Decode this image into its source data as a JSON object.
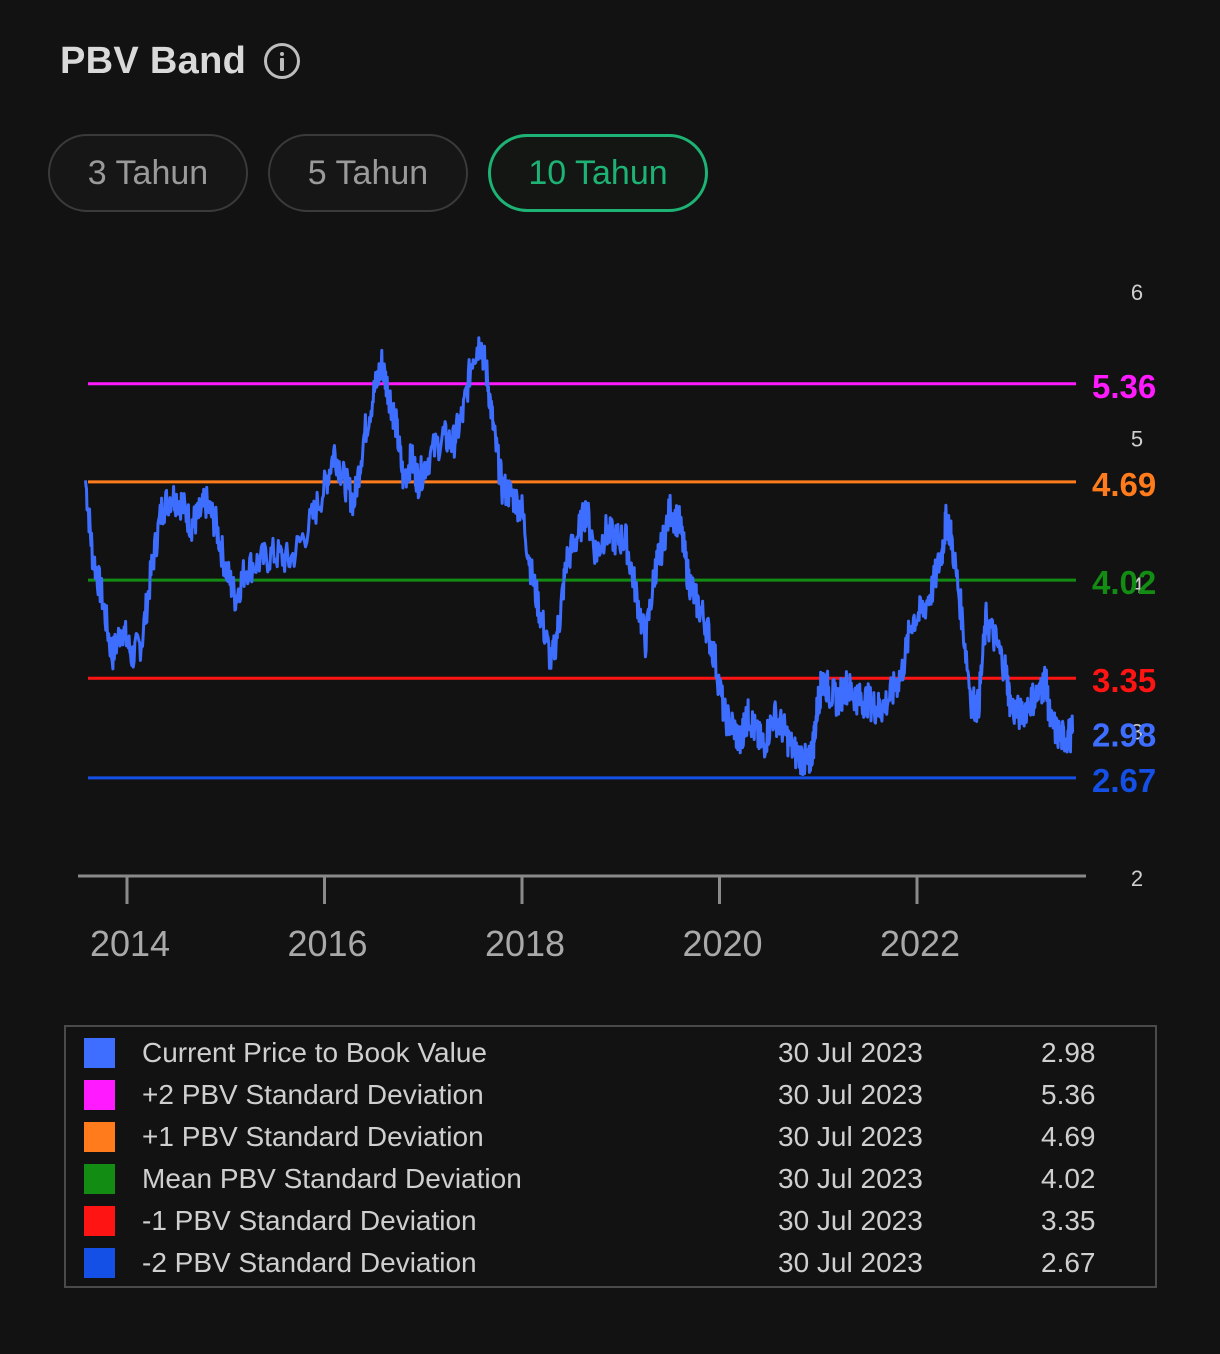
{
  "header": {
    "title": "PBV Band"
  },
  "tabs": [
    {
      "label": "3 Tahun",
      "active": false
    },
    {
      "label": "5 Tahun",
      "active": false
    },
    {
      "label": "10 Tahun",
      "active": true
    }
  ],
  "colors": {
    "accent": "#1db374",
    "series": "#3d6eff"
  },
  "chart_data": {
    "type": "line",
    "title": "PBV Band",
    "xlabel": "",
    "ylabel": "",
    "x_ticks": [
      "2014",
      "2016",
      "2018",
      "2020",
      "2022"
    ],
    "y_ticks": [
      "2",
      "3",
      "4",
      "5",
      "6"
    ],
    "ylim": [
      2,
      6
    ],
    "xlim": [
      2013.58,
      2023.58
    ],
    "grid": false,
    "bands": [
      {
        "name": "+2 PBV Standard Deviation",
        "value": 5.36,
        "label": "5.36",
        "color": "#ff1aff"
      },
      {
        "name": "+1 PBV Standard Deviation",
        "value": 4.69,
        "label": "4.69",
        "color": "#ff7b1c"
      },
      {
        "name": "Mean PBV Standard Deviation",
        "value": 4.02,
        "label": "4.02",
        "color": "#128c12"
      },
      {
        "name": "-1 PBV Standard Deviation",
        "value": 3.35,
        "label": "3.35",
        "color": "#ff1414"
      },
      {
        "name": "-2 PBV Standard Deviation",
        "value": 2.67,
        "label": "2.67",
        "color": "#1450e6"
      }
    ],
    "current": {
      "value": 2.98,
      "label": "2.98",
      "color": "#3d6eff"
    },
    "series": [
      {
        "name": "Current Price to Book Value",
        "color": "#3d6eff",
        "x": [
          2013.58,
          2013.65,
          2013.75,
          2013.85,
          2013.95,
          2014.05,
          2014.15,
          2014.25,
          2014.35,
          2014.45,
          2014.55,
          2014.65,
          2014.72,
          2014.8,
          2014.9,
          2015.0,
          2015.1,
          2015.2,
          2015.35,
          2015.5,
          2015.65,
          2015.85,
          2016.0,
          2016.1,
          2016.2,
          2016.3,
          2016.4,
          2016.5,
          2016.58,
          2016.65,
          2016.72,
          2016.8,
          2016.88,
          2016.95,
          2017.05,
          2017.2,
          2017.3,
          2017.4,
          2017.5,
          2017.58,
          2017.65,
          2017.72,
          2017.8,
          2017.9,
          2018.0,
          2018.1,
          2018.2,
          2018.3,
          2018.38,
          2018.45,
          2018.55,
          2018.65,
          2018.75,
          2018.85,
          2018.95,
          2019.05,
          2019.15,
          2019.25,
          2019.35,
          2019.4,
          2019.5,
          2019.6,
          2019.68,
          2019.75,
          2019.85,
          2019.95,
          2020.05,
          2020.15,
          2020.22,
          2020.25,
          2020.3,
          2020.38,
          2020.45,
          2020.55,
          2020.65,
          2020.75,
          2020.85,
          2020.9,
          2020.95,
          2021.0,
          2021.05,
          2021.12,
          2021.2,
          2021.28,
          2021.35,
          2021.42,
          2021.5,
          2021.58,
          2021.65,
          2021.75,
          2021.85,
          2021.95,
          2022.05,
          2022.15,
          2022.25,
          2022.3,
          2022.35,
          2022.45,
          2022.55,
          2022.62,
          2022.7,
          2022.8,
          2022.9,
          2022.95,
          2023.05,
          2023.15,
          2023.25,
          2023.3,
          2023.35,
          2023.45,
          2023.52,
          2023.58
        ],
        "y": [
          4.7,
          4.2,
          3.9,
          3.5,
          3.7,
          3.5,
          3.6,
          4.1,
          4.5,
          4.6,
          4.55,
          4.4,
          4.45,
          4.55,
          4.4,
          4.1,
          3.9,
          4.1,
          4.15,
          4.2,
          4.15,
          4.4,
          4.65,
          4.9,
          4.7,
          4.55,
          5.0,
          5.3,
          5.5,
          5.3,
          5.1,
          4.7,
          4.85,
          4.7,
          4.85,
          5.0,
          4.95,
          5.15,
          5.55,
          5.65,
          5.4,
          5.0,
          4.65,
          4.6,
          4.5,
          4.05,
          3.75,
          3.45,
          3.75,
          4.15,
          4.3,
          4.5,
          4.2,
          4.35,
          4.3,
          4.3,
          3.95,
          3.6,
          4.1,
          4.2,
          4.5,
          4.4,
          4.05,
          3.9,
          3.75,
          3.5,
          3.1,
          3.0,
          2.9,
          3.05,
          3.1,
          2.95,
          2.9,
          3.1,
          3.0,
          2.85,
          2.8,
          2.75,
          2.9,
          3.2,
          3.35,
          3.25,
          3.2,
          3.3,
          3.25,
          3.2,
          3.2,
          3.15,
          3.15,
          3.25,
          3.4,
          3.75,
          3.8,
          3.95,
          4.2,
          4.45,
          4.3,
          3.8,
          3.2,
          3.15,
          3.75,
          3.6,
          3.4,
          3.15,
          3.1,
          3.2,
          3.25,
          3.35,
          3.05,
          2.95,
          2.95,
          2.98
        ]
      }
    ]
  },
  "legend": {
    "rows": [
      {
        "label": "Current Price to Book Value",
        "date": "30 Jul 2023",
        "value": "2.98",
        "color": "#3d6eff"
      },
      {
        "label": "+2 PBV Standard Deviation",
        "date": "30 Jul 2023",
        "value": "5.36",
        "color": "#ff1aff"
      },
      {
        "label": "+1 PBV Standard Deviation",
        "date": "30 Jul 2023",
        "value": "4.69",
        "color": "#ff7b1c"
      },
      {
        "label": "Mean PBV Standard Deviation",
        "date": "30 Jul 2023",
        "value": "4.02",
        "color": "#128c12"
      },
      {
        "label": "-1 PBV Standard Deviation",
        "date": "30 Jul 2023",
        "value": "3.35",
        "color": "#ff1414"
      },
      {
        "label": "-2 PBV Standard Deviation",
        "date": "30 Jul 2023",
        "value": "2.67",
        "color": "#1450e6"
      }
    ]
  }
}
